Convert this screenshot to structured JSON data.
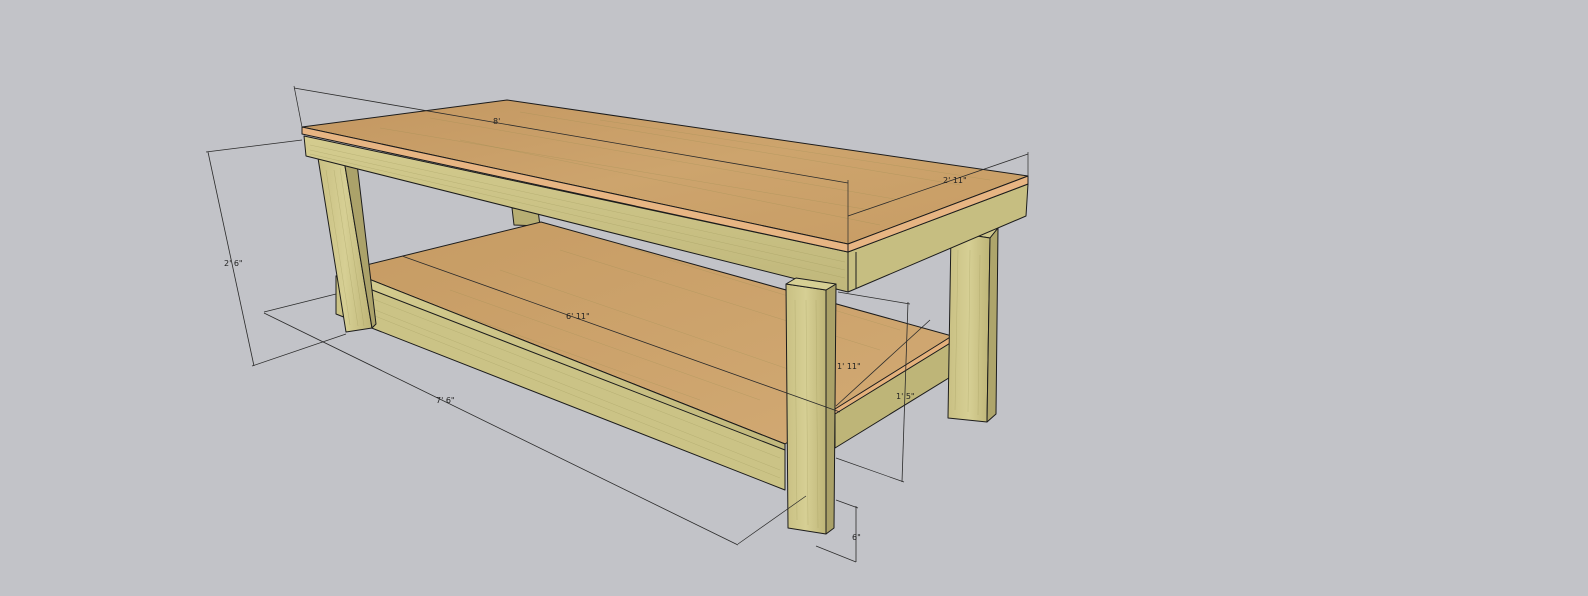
{
  "model": {
    "name": "workbench",
    "colors": {
      "background": "#c2c3c8",
      "plywood_top": "#c9a06a",
      "plywood_edge": "#e7b583",
      "lumber_light": "#d3cc8f",
      "lumber_mid": "#bfb67a",
      "lumber_dark": "#a89f66",
      "dimension_line": "#2a2a2a"
    }
  },
  "dimensions": {
    "top_length": "8'",
    "top_width": "2' 11\"",
    "overall_height": "2' 6\"",
    "shelf_length": "6' 11\"",
    "shelf_width": "1' 11\"",
    "base_length": "7' 6\"",
    "shelf_height": "1' 5\"",
    "leg_clearance": "6\""
  }
}
